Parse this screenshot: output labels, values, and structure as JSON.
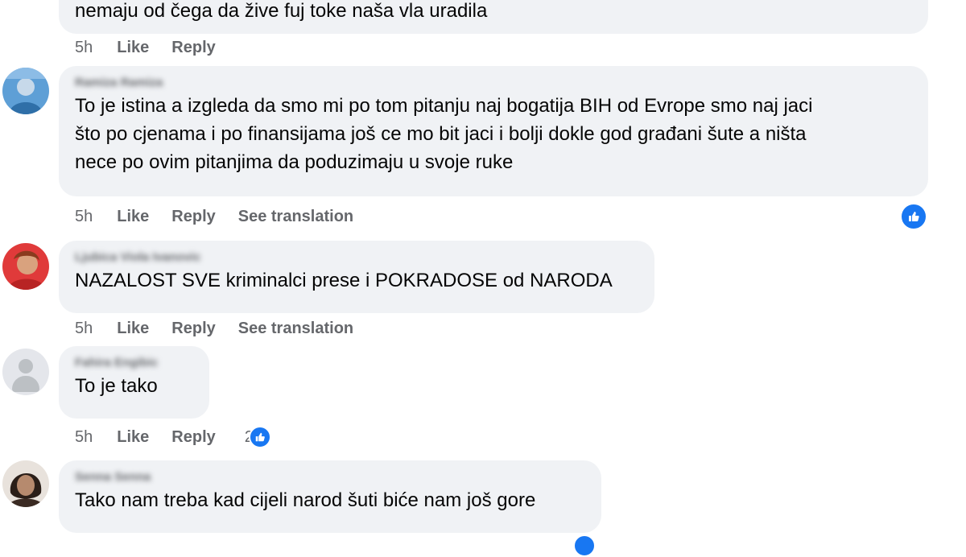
{
  "actions": {
    "like": "Like",
    "reply": "Reply",
    "see_translation": "See translation"
  },
  "comments": [
    {
      "author": "",
      "text": "nemaju od čega da žive fuj toke naša vla uradila",
      "time": "5h"
    },
    {
      "author": "Ramiza Ramiza",
      "text": "To je istina a izgleda da smo mi po tom pitanju naj bogatija BIH od Evrope smo naj jaci\nšto po cjenama i po finansijama još ce mo bit jaci i bolji dokle god građani šute a ništa\nnece po ovim pitanjima da poduzimaju u svoje ruke",
      "time": "5h"
    },
    {
      "author": "Ljubica Viola Ivanovic",
      "text": "NAZALOST SVE kriminalci prese i POKRADOSE od NARODA",
      "time": "5h"
    },
    {
      "author": "Fahira Engibic",
      "text": "To je tako",
      "time": "5h",
      "reactions": "2"
    },
    {
      "author": "Senna Senna",
      "text": "Tako nam treba kad cijeli narod šuti biće nam još gore",
      "time": ""
    }
  ],
  "colors": {
    "bubble": "#f0f2f5",
    "meta": "#65676b",
    "reaction": "#1877f2"
  },
  "icons": {
    "reaction": "like-reaction-icon",
    "default_avatar": "default-avatar-icon"
  }
}
